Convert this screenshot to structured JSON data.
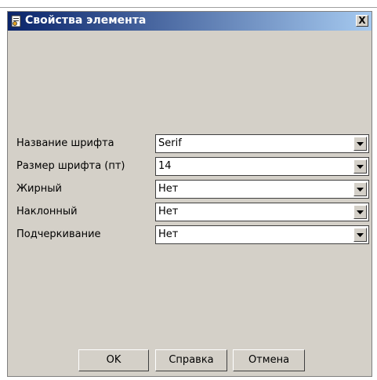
{
  "dialog": {
    "title": "Свойства элемента",
    "close_label": "X"
  },
  "fields": [
    {
      "label": "Название шрифта",
      "value": "Serif"
    },
    {
      "label": "Размер шрифта (пт)",
      "value": "14"
    },
    {
      "label": "Жирный",
      "value": "Нет"
    },
    {
      "label": "Наклонный",
      "value": "Нет"
    },
    {
      "label": "Подчеркивание",
      "value": "Нет"
    }
  ],
  "buttons": {
    "ok": "OK",
    "help": "Справка",
    "cancel": "Отмена"
  },
  "colors": {
    "titlebar_start": "#0a246a",
    "titlebar_end": "#a6caf0",
    "dialog_bg": "#d4d0c8"
  },
  "icons": {
    "title": "document-icon",
    "close": "close-icon",
    "dropdown": "chevron-down-icon"
  }
}
